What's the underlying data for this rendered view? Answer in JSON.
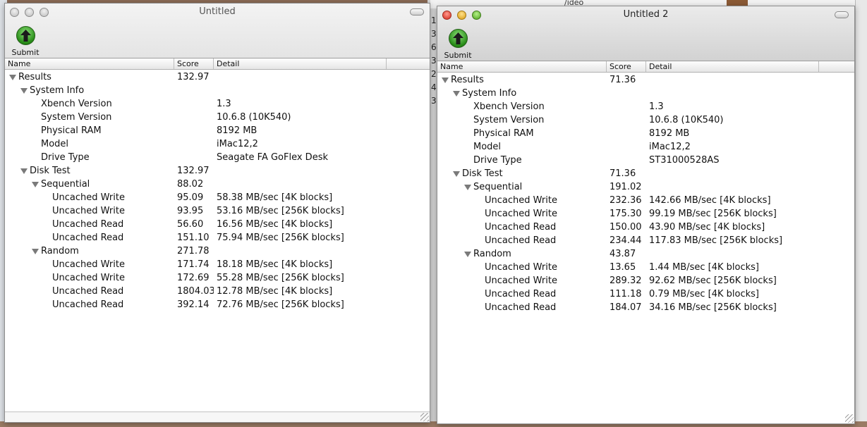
{
  "background": {
    "top_text": "/ideo",
    "gap_numbers": [
      "1",
      "3",
      "6",
      "3",
      "2",
      "4",
      "3"
    ]
  },
  "windows": [
    {
      "title": "Untitled",
      "active": false,
      "submit_label": "Submit",
      "columns": {
        "name": "Name",
        "score": "Score",
        "detail": "Detail"
      },
      "rows": [
        {
          "level": 0,
          "expand": true,
          "name": "Results",
          "score": "132.97",
          "detail": ""
        },
        {
          "level": 1,
          "expand": true,
          "name": "System Info",
          "score": "",
          "detail": ""
        },
        {
          "level": 2,
          "expand": false,
          "name": "Xbench Version",
          "score": "",
          "detail": "1.3"
        },
        {
          "level": 2,
          "expand": false,
          "name": "System Version",
          "score": "",
          "detail": "10.6.8 (10K540)"
        },
        {
          "level": 2,
          "expand": false,
          "name": "Physical RAM",
          "score": "",
          "detail": "8192 MB"
        },
        {
          "level": 2,
          "expand": false,
          "name": "Model",
          "score": "",
          "detail": "iMac12,2"
        },
        {
          "level": 2,
          "expand": false,
          "name": "Drive Type",
          "score": "",
          "detail": "Seagate FA GoFlex Desk"
        },
        {
          "level": 1,
          "expand": true,
          "name": "Disk Test",
          "score": "132.97",
          "detail": ""
        },
        {
          "level": 2,
          "expand": true,
          "name": "Sequential",
          "score": "88.02",
          "detail": ""
        },
        {
          "level": 3,
          "expand": false,
          "name": "Uncached Write",
          "score": "95.09",
          "detail": "58.38 MB/sec [4K blocks]"
        },
        {
          "level": 3,
          "expand": false,
          "name": "Uncached Write",
          "score": "93.95",
          "detail": "53.16 MB/sec [256K blocks]"
        },
        {
          "level": 3,
          "expand": false,
          "name": "Uncached Read",
          "score": "56.60",
          "detail": "16.56 MB/sec [4K blocks]"
        },
        {
          "level": 3,
          "expand": false,
          "name": "Uncached Read",
          "score": "151.10",
          "detail": "75.94 MB/sec [256K blocks]"
        },
        {
          "level": 2,
          "expand": true,
          "name": "Random",
          "score": "271.78",
          "detail": ""
        },
        {
          "level": 3,
          "expand": false,
          "name": "Uncached Write",
          "score": "171.74",
          "detail": "18.18 MB/sec [4K blocks]"
        },
        {
          "level": 3,
          "expand": false,
          "name": "Uncached Write",
          "score": "172.69",
          "detail": "55.28 MB/sec [256K blocks]"
        },
        {
          "level": 3,
          "expand": false,
          "name": "Uncached Read",
          "score": "1804.03",
          "detail": "12.78 MB/sec [4K blocks]"
        },
        {
          "level": 3,
          "expand": false,
          "name": "Uncached Read",
          "score": "392.14",
          "detail": "72.76 MB/sec [256K blocks]"
        }
      ]
    },
    {
      "title": "Untitled 2",
      "active": true,
      "submit_label": "Submit",
      "columns": {
        "name": "Name",
        "score": "Score",
        "detail": "Detail"
      },
      "rows": [
        {
          "level": 0,
          "expand": true,
          "name": "Results",
          "score": "71.36",
          "detail": ""
        },
        {
          "level": 1,
          "expand": true,
          "name": "System Info",
          "score": "",
          "detail": ""
        },
        {
          "level": 2,
          "expand": false,
          "name": "Xbench Version",
          "score": "",
          "detail": "1.3"
        },
        {
          "level": 2,
          "expand": false,
          "name": "System Version",
          "score": "",
          "detail": "10.6.8 (10K540)"
        },
        {
          "level": 2,
          "expand": false,
          "name": "Physical RAM",
          "score": "",
          "detail": "8192 MB"
        },
        {
          "level": 2,
          "expand": false,
          "name": "Model",
          "score": "",
          "detail": "iMac12,2"
        },
        {
          "level": 2,
          "expand": false,
          "name": "Drive Type",
          "score": "",
          "detail": "ST31000528AS"
        },
        {
          "level": 1,
          "expand": true,
          "name": "Disk Test",
          "score": "71.36",
          "detail": ""
        },
        {
          "level": 2,
          "expand": true,
          "name": "Sequential",
          "score": "191.02",
          "detail": ""
        },
        {
          "level": 3,
          "expand": false,
          "name": "Uncached Write",
          "score": "232.36",
          "detail": "142.66 MB/sec [4K blocks]"
        },
        {
          "level": 3,
          "expand": false,
          "name": "Uncached Write",
          "score": "175.30",
          "detail": "99.19 MB/sec [256K blocks]"
        },
        {
          "level": 3,
          "expand": false,
          "name": "Uncached Read",
          "score": "150.00",
          "detail": "43.90 MB/sec [4K blocks]"
        },
        {
          "level": 3,
          "expand": false,
          "name": "Uncached Read",
          "score": "234.44",
          "detail": "117.83 MB/sec [256K blocks]"
        },
        {
          "level": 2,
          "expand": true,
          "name": "Random",
          "score": "43.87",
          "detail": ""
        },
        {
          "level": 3,
          "expand": false,
          "name": "Uncached Write",
          "score": "13.65",
          "detail": "1.44 MB/sec [4K blocks]"
        },
        {
          "level": 3,
          "expand": false,
          "name": "Uncached Write",
          "score": "289.32",
          "detail": "92.62 MB/sec [256K blocks]"
        },
        {
          "level": 3,
          "expand": false,
          "name": "Uncached Read",
          "score": "111.18",
          "detail": "0.79 MB/sec [4K blocks]"
        },
        {
          "level": 3,
          "expand": false,
          "name": "Uncached Read",
          "score": "184.07",
          "detail": "34.16 MB/sec [256K blocks]"
        }
      ]
    }
  ]
}
